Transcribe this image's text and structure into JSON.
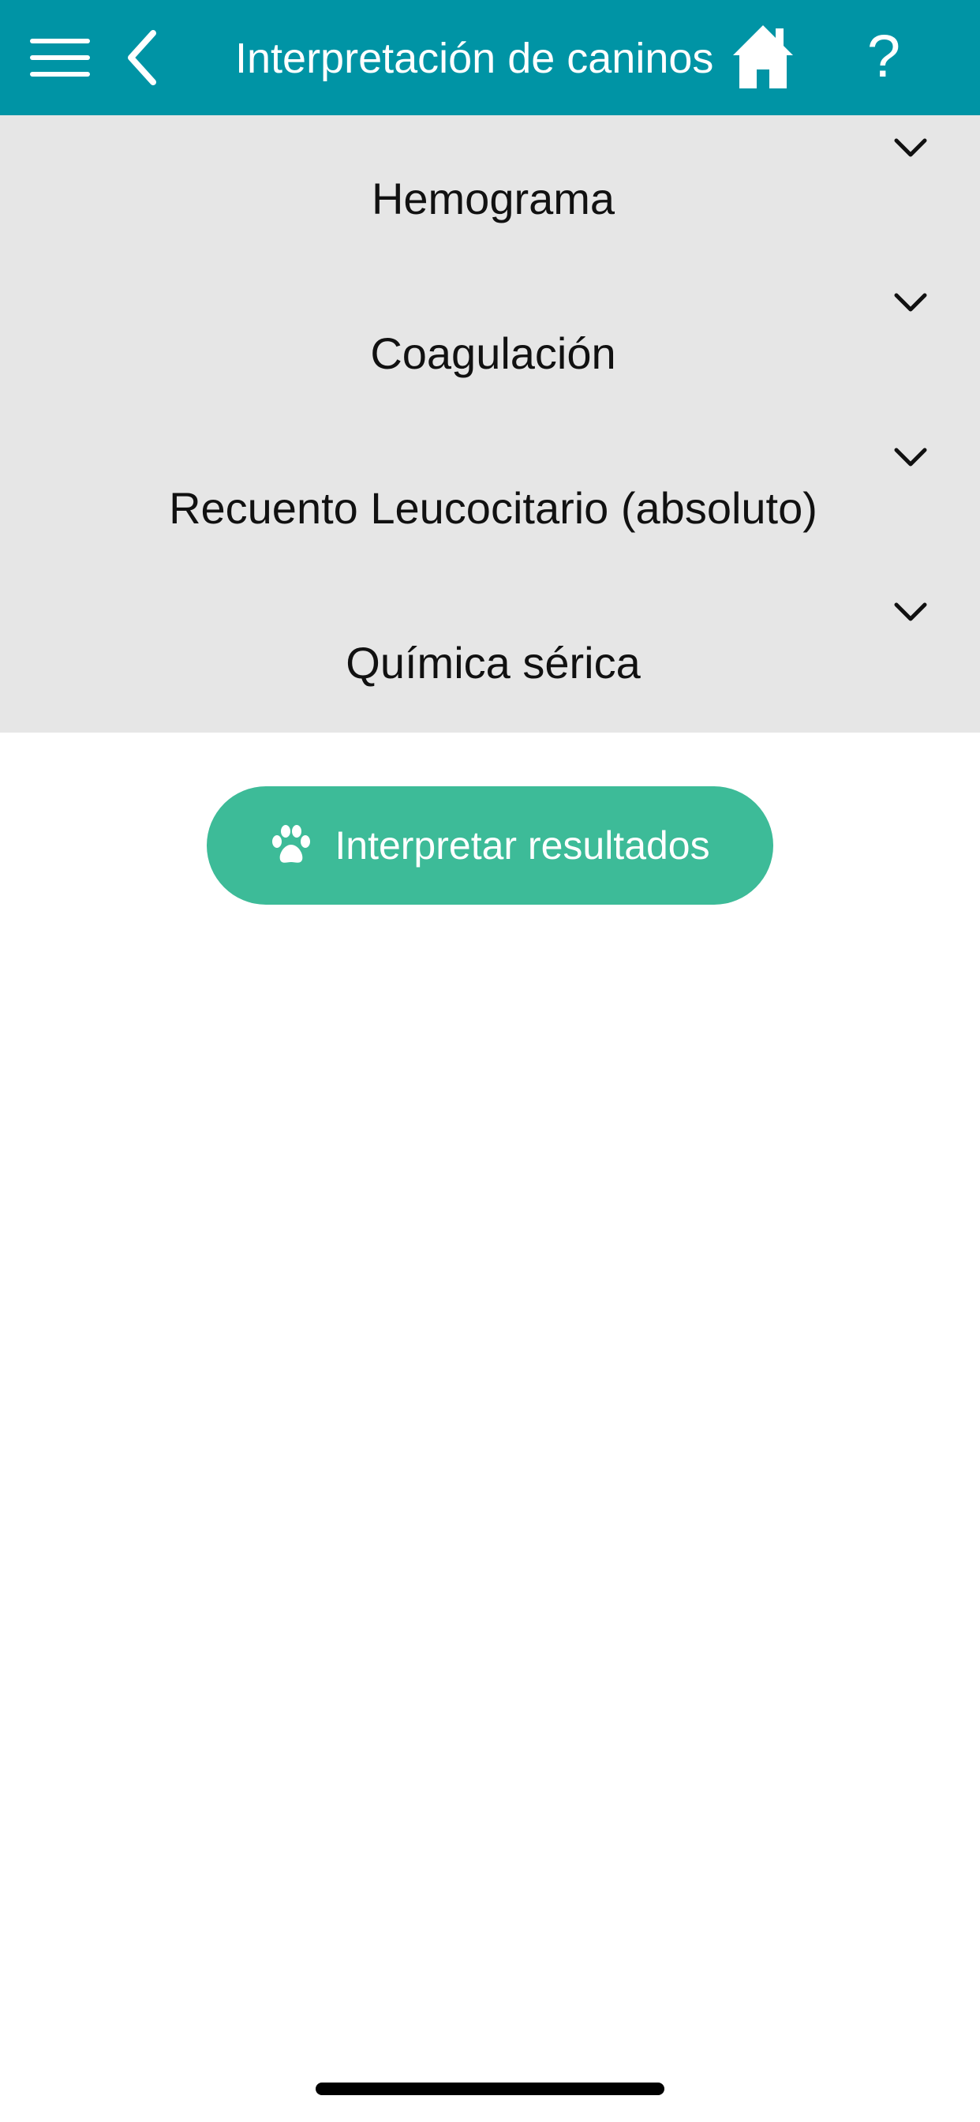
{
  "header": {
    "title": "Interpretación de caninos",
    "menu_icon": "hamburger-menu-icon",
    "back_icon": "chevron-left-icon",
    "home_icon": "home-icon",
    "help_label": "?",
    "background_color": "#0094a5"
  },
  "sections": [
    {
      "label": "Hemograma",
      "icon": "chevron-down-icon"
    },
    {
      "label": "Coagulación",
      "icon": "chevron-down-icon"
    },
    {
      "label": "Recuento Leucocitario (absoluto)",
      "icon": "chevron-down-icon"
    },
    {
      "label": "Química sérica",
      "icon": "chevron-down-icon"
    }
  ],
  "interpret_button": {
    "label": "Interpretar resultados",
    "icon": "paw-icon",
    "color": "#3dbb98"
  }
}
